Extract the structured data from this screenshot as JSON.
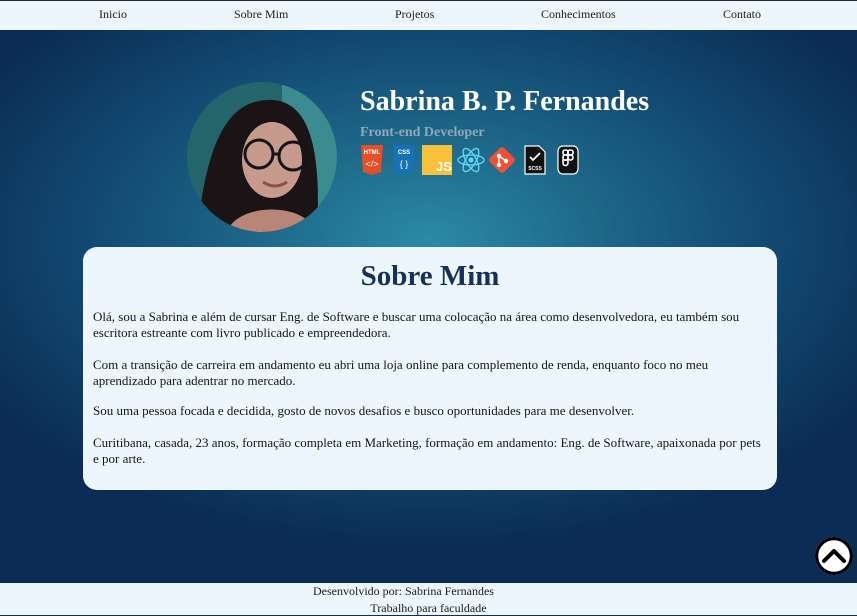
{
  "nav": {
    "items": [
      {
        "label": "Inicio"
      },
      {
        "label": "Sobre Mim"
      },
      {
        "label": "Projetos"
      },
      {
        "label": "Conhecimentos"
      },
      {
        "label": "Contato"
      }
    ]
  },
  "profile": {
    "name": "Sabrina B. P. Fernandes",
    "role": "Front-end Developer",
    "skills": [
      {
        "icon": "html5-icon",
        "text": "HTML"
      },
      {
        "icon": "css3-icon",
        "text": "CSS"
      },
      {
        "icon": "javascript-icon",
        "text": "JS"
      },
      {
        "icon": "react-icon"
      },
      {
        "icon": "git-icon"
      },
      {
        "icon": "sass-icon",
        "text": "SCSS"
      },
      {
        "icon": "figma-icon"
      }
    ]
  },
  "about": {
    "title": "Sobre Mim",
    "paragraphs": [
      "Olá, sou a Sabrina e além de cursar Eng. de Software e buscar uma colocação na área como desenvolvedora, eu também sou escritora estreante com livro publicado e empreendedora.",
      "Com a transição de carreira em andamento eu abri uma loja online para complemento de renda, enquanto foco no meu aprendizado para adentrar no mercado.",
      "Sou uma pessoa focada e decidida, gosto de novos desafios e busco oportunidades para me desenvolver.",
      "Curitibana, casada, 23 anos, formação completa em Marketing, formação em andamento: Eng. de Software, apaixonada por pets e por arte."
    ]
  },
  "footer": {
    "line1": "Desenvolvido por: Sabrina Fernandes",
    "line2": "Trabalho para faculdade"
  },
  "colors": {
    "accent": "#17305a",
    "background_dark": "#0c2f55",
    "panel": "#eef6fd"
  }
}
